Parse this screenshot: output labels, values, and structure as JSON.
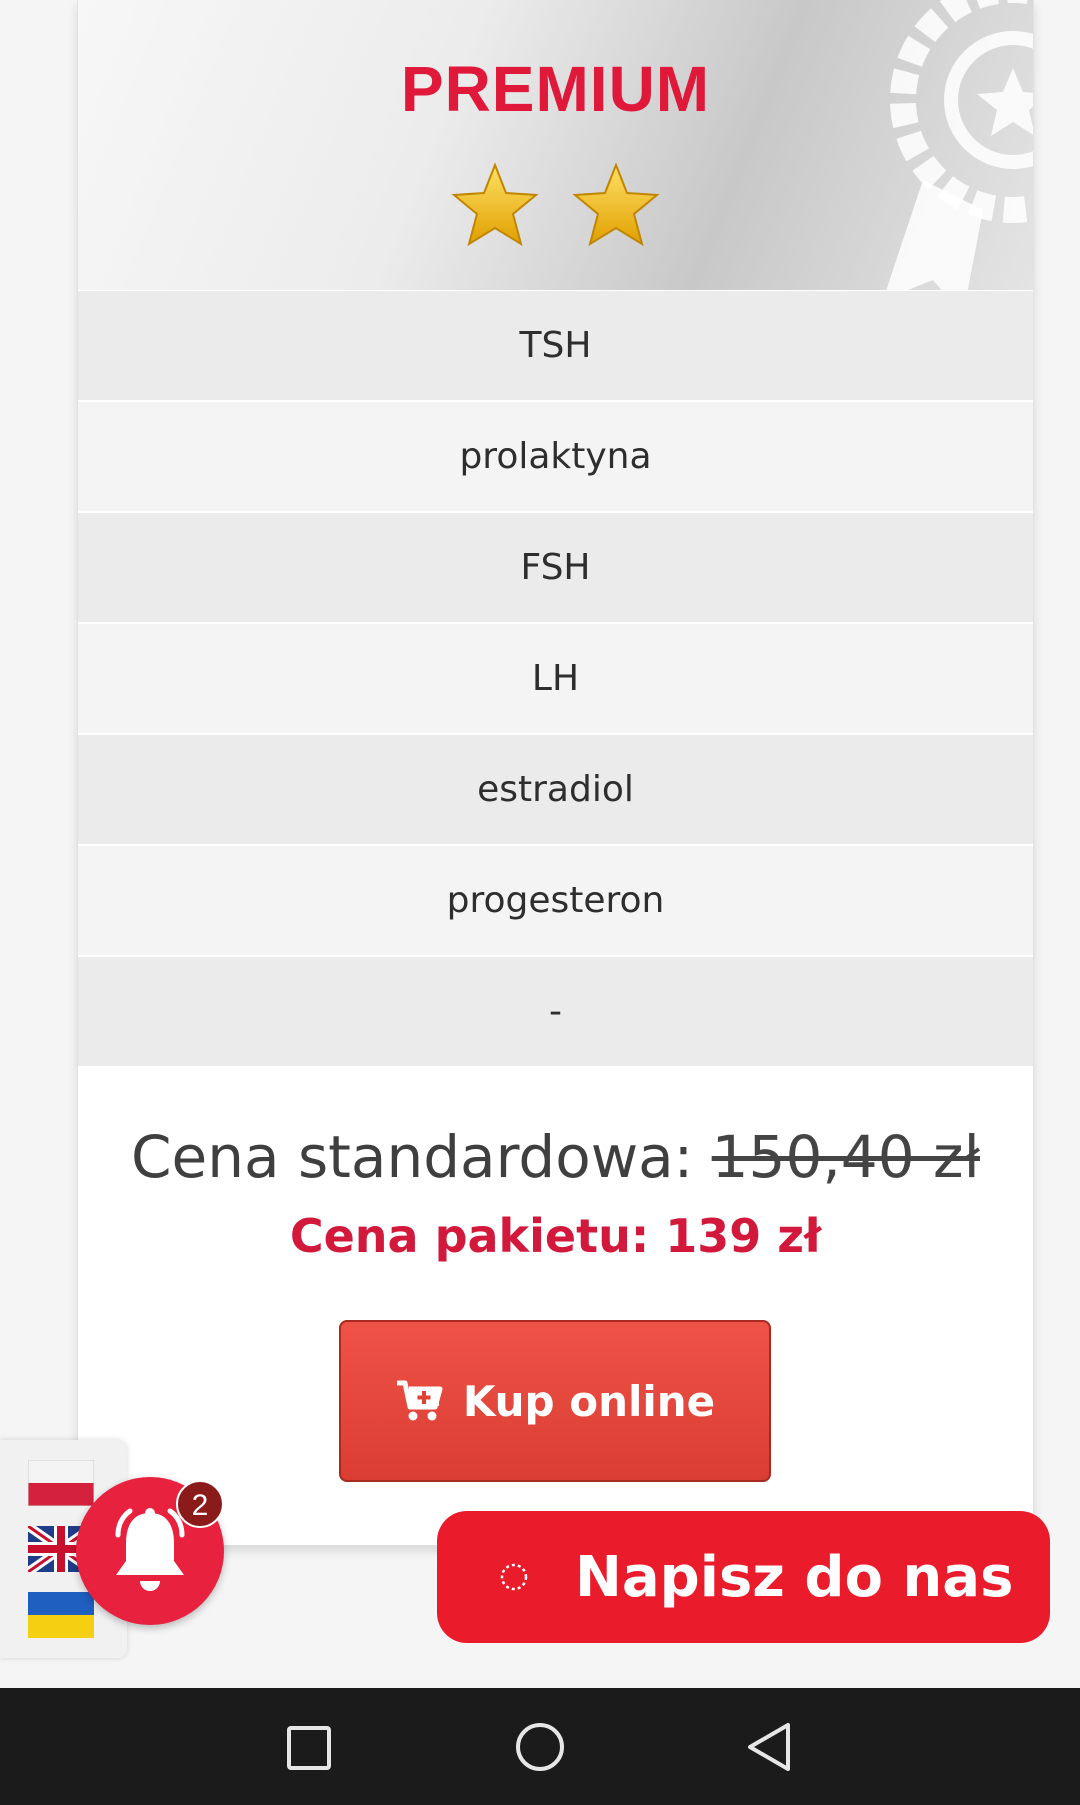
{
  "plan": {
    "title": "PREMIUM",
    "rating": 2,
    "tests": [
      "TSH",
      "prolaktyna",
      "FSH",
      "LH",
      "estradiol",
      "progesteron",
      "-"
    ]
  },
  "pricing": {
    "standard_label": "Cena standardowa:",
    "standard_price": "150,40 zł",
    "package_text": "Cena pakietu: 139 zł"
  },
  "buy_button": {
    "label": "Kup online",
    "icon": "cart-plus-icon"
  },
  "languages": [
    "pl-flag",
    "uk-flag",
    "ua-flag"
  ],
  "notifications": {
    "count": "2",
    "icon": "bell-icon"
  },
  "chat": {
    "label": "Napisz do nas",
    "icon": "chat-bubble-icon"
  },
  "system_nav": [
    "recent-apps-icon",
    "home-icon",
    "back-icon"
  ],
  "colors": {
    "brand_red": "#e0183a",
    "button_red": "#e8473c",
    "chat_red": "#ea1b2a"
  }
}
